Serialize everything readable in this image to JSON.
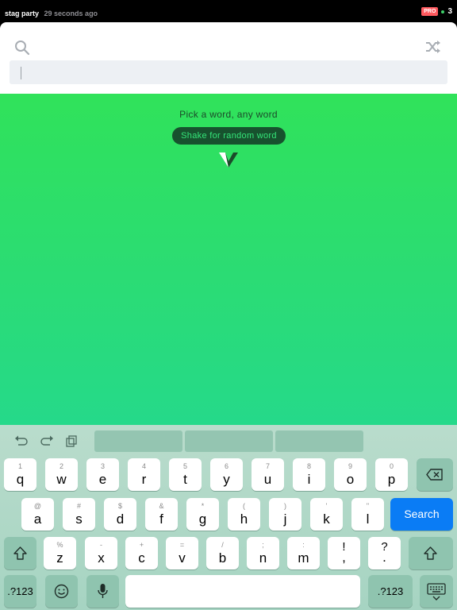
{
  "status_bar": {
    "name": "stag party",
    "time": "29 seconds ago",
    "badge": "PRO",
    "count": "3"
  },
  "header": {
    "search_icon": "search-icon",
    "shuffle_icon": "shuffle-icon",
    "search_value": ""
  },
  "main": {
    "prompt": "Pick a word, any word",
    "shake_label": "Shake for random word",
    "logo": "app-logo"
  },
  "keyboard": {
    "toolbar": [
      "undo-icon",
      "redo-icon",
      "clipboard-icon"
    ],
    "row1": [
      {
        "hint": "1",
        "char": "q"
      },
      {
        "hint": "2",
        "char": "w"
      },
      {
        "hint": "3",
        "char": "e"
      },
      {
        "hint": "4",
        "char": "r"
      },
      {
        "hint": "5",
        "char": "t"
      },
      {
        "hint": "6",
        "char": "y"
      },
      {
        "hint": "7",
        "char": "u"
      },
      {
        "hint": "8",
        "char": "i"
      },
      {
        "hint": "9",
        "char": "o"
      },
      {
        "hint": "0",
        "char": "p"
      }
    ],
    "row2": [
      {
        "hint": "@",
        "char": "a"
      },
      {
        "hint": "#",
        "char": "s"
      },
      {
        "hint": "$",
        "char": "d"
      },
      {
        "hint": "&",
        "char": "f"
      },
      {
        "hint": "*",
        "char": "g"
      },
      {
        "hint": "(",
        "char": "h"
      },
      {
        "hint": ")",
        "char": "j"
      },
      {
        "hint": "'",
        "char": "k"
      },
      {
        "hint": "\"",
        "char": "l"
      }
    ],
    "row3": [
      {
        "hint": "%",
        "char": "z"
      },
      {
        "hint": "-",
        "char": "x"
      },
      {
        "hint": "+",
        "char": "c"
      },
      {
        "hint": "=",
        "char": "v"
      },
      {
        "hint": "/",
        "char": "b"
      },
      {
        "hint": ";",
        "char": "n"
      },
      {
        "hint": ":",
        "char": "m"
      },
      {
        "hint": "!",
        "char": ","
      },
      {
        "hint": "?",
        "char": "."
      }
    ],
    "search_label": "Search",
    "numbers_label": ".?123"
  }
}
